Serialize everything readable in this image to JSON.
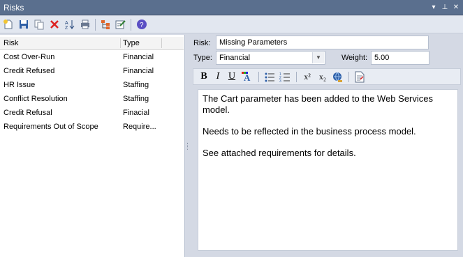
{
  "window": {
    "title": "Risks",
    "controls": {
      "dropdown": "▾",
      "pin": "⊥",
      "close": "✕"
    }
  },
  "toolbar": {
    "icons": [
      "new-icon",
      "save-icon",
      "copy-icon",
      "delete-icon",
      "sort-icon",
      "print-icon",
      "hierarchy-icon",
      "edit-icon",
      "help-icon"
    ]
  },
  "list": {
    "columns": [
      "Risk",
      "Type"
    ],
    "rows": [
      {
        "risk": "Cost Over-Run",
        "type": "Financial"
      },
      {
        "risk": "Credit Refused",
        "type": "Financial"
      },
      {
        "risk": "HR Issue",
        "type": "Staffing"
      },
      {
        "risk": "Conflict Resolution",
        "type": "Staffing"
      },
      {
        "risk": "Credit Refusal",
        "type": "Finacial"
      },
      {
        "risk": "Requirements Out of Scope",
        "type": "Require..."
      }
    ]
  },
  "details": {
    "risk_label": "Risk:",
    "risk_value": "Missing Parameters",
    "type_label": "Type:",
    "type_value": "Financial",
    "weight_label": "Weight:",
    "weight_value": "5.00"
  },
  "format": {
    "bold": "B",
    "italic": "I",
    "underline": "U",
    "superscript": "x²",
    "subscript": "x₂"
  },
  "notes": {
    "p1": "The Cart parameter has been added to the Web Services model.",
    "p2": "Needs to be reflected in the business process model.",
    "p3": "See attached requirements for details."
  },
  "colors": {
    "titlebar": "#5a6f8e",
    "accent_blue": "#2e5fa8",
    "background": "#d4d9e4"
  }
}
